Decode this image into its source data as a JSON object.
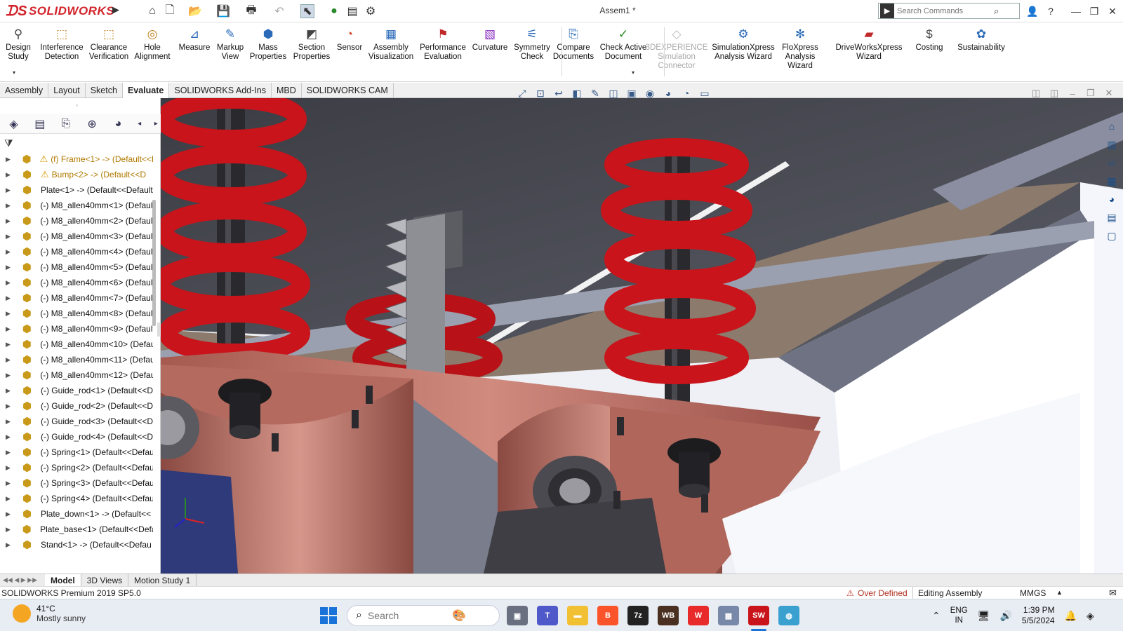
{
  "app": {
    "name": "SOLIDWORKS",
    "document_title": "Assem1 *"
  },
  "search": {
    "placeholder": "Search Commands"
  },
  "ribbon": [
    {
      "label": "Design Study",
      "icon": "design-study-icon"
    },
    {
      "label": "Interference Detection",
      "icon": "interference-detection-icon"
    },
    {
      "label": "Clearance Verification",
      "icon": "clearance-verification-icon"
    },
    {
      "label": "Hole Alignment",
      "icon": "hole-alignment-icon"
    },
    {
      "label": "Measure",
      "icon": "measure-icon"
    },
    {
      "label": "Markup View",
      "icon": "markup-view-icon"
    },
    {
      "label": "Mass Properties",
      "icon": "mass-properties-icon"
    },
    {
      "label": "Section Properties",
      "icon": "section-properties-icon"
    },
    {
      "label": "Sensor",
      "icon": "sensor-icon"
    },
    {
      "label": "Assembly Visualization",
      "icon": "assembly-visualization-icon"
    },
    {
      "label": "Performance Evaluation",
      "icon": "performance-evaluation-icon"
    },
    {
      "label": "Curvature",
      "icon": "curvature-icon"
    },
    {
      "label": "Symmetry Check",
      "icon": "symmetry-check-icon"
    },
    {
      "label": "Compare Documents",
      "icon": "compare-documents-icon"
    },
    {
      "label": "Check Active Document",
      "icon": "check-active-document-icon"
    },
    {
      "label": "3DEXPERIENCE Simulation Connector",
      "icon": "simulation-connector-icon",
      "disabled": true
    },
    {
      "label": "SimulationXpress Analysis Wizard",
      "icon": "simulationxpress-icon"
    },
    {
      "label": "FloXpress Analysis Wizard",
      "icon": "floxpress-icon"
    },
    {
      "label": "DriveWorksXpress Wizard",
      "icon": "driveworksxpress-icon"
    },
    {
      "label": "Costing",
      "icon": "costing-icon"
    },
    {
      "label": "Sustainability",
      "icon": "sustainability-icon"
    }
  ],
  "tabs": [
    "Assembly",
    "Layout",
    "Sketch",
    "Evaluate",
    "SOLIDWORKS Add-Ins",
    "MBD",
    "SOLIDWORKS CAM"
  ],
  "active_tab": "Evaluate",
  "tree": [
    {
      "label": "(f) Frame<1> -> (Default<<D",
      "warn": true
    },
    {
      "label": "Bump<2> -> (Default<<D",
      "warn": true
    },
    {
      "label": "Plate<1> -> (Default<<Default"
    },
    {
      "label": "(-) M8_allen40mm<1> (Default"
    },
    {
      "label": "(-) M8_allen40mm<2> (Default"
    },
    {
      "label": "(-) M8_allen40mm<3> (Default"
    },
    {
      "label": "(-) M8_allen40mm<4> (Default"
    },
    {
      "label": "(-) M8_allen40mm<5> (Default"
    },
    {
      "label": "(-) M8_allen40mm<6> (Default"
    },
    {
      "label": "(-) M8_allen40mm<7> (Default"
    },
    {
      "label": "(-) M8_allen40mm<8> (Default"
    },
    {
      "label": "(-) M8_allen40mm<9> (Default"
    },
    {
      "label": "(-) M8_allen40mm<10> (Defau"
    },
    {
      "label": "(-) M8_allen40mm<11> (Defau"
    },
    {
      "label": "(-) M8_allen40mm<12> (Defau"
    },
    {
      "label": "(-) Guide_rod<1> (Default<<D"
    },
    {
      "label": "(-) Guide_rod<2> (Default<<D"
    },
    {
      "label": "(-) Guide_rod<3> (Default<<D"
    },
    {
      "label": "(-) Guide_rod<4> (Default<<D"
    },
    {
      "label": "(-) Spring<1> (Default<<Defau"
    },
    {
      "label": "(-) Spring<2> (Default<<Defau"
    },
    {
      "label": "(-) Spring<3> (Default<<Defau"
    },
    {
      "label": "(-) Spring<4> (Default<<Defau"
    },
    {
      "label": "Plate_down<1> -> (Default<<"
    },
    {
      "label": "Plate_base<1> (Default<<Defa"
    },
    {
      "label": "Stand<1> -> (Default<<Defau"
    }
  ],
  "bottom_tabs": [
    "Model",
    "3D Views",
    "Motion Study 1"
  ],
  "status": {
    "version": "SOLIDWORKS Premium 2019 SP5.0",
    "over_defined": "Over Defined",
    "editing": "Editing Assembly",
    "units": "MMGS"
  },
  "taskbar": {
    "temperature": "41°C",
    "weather": "Mostly sunny",
    "search_placeholder": "Search",
    "lang1": "ENG",
    "lang2": "IN",
    "time": "1:39 PM",
    "date": "5/5/2024"
  },
  "colors": {
    "spring": "#c8141a",
    "plate": "#b86c62",
    "frame": "#7b7f90",
    "accent": "#d2232a"
  }
}
